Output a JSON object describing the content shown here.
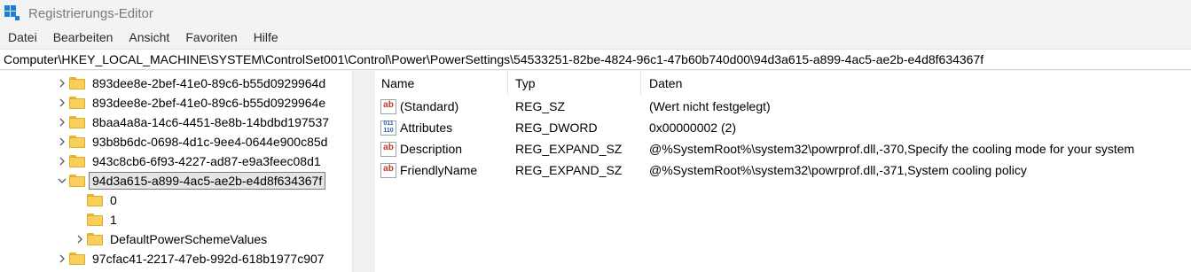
{
  "window": {
    "title": "Registrierungs-Editor"
  },
  "menu": [
    "Datei",
    "Bearbeiten",
    "Ansicht",
    "Favoriten",
    "Hilfe"
  ],
  "address": "Computer\\HKEY_LOCAL_MACHINE\\SYSTEM\\ControlSet001\\Control\\Power\\PowerSettings\\54533251-82be-4824-96c1-47b60b740d00\\94d3a615-a899-4ac5-ae2b-e4d8f634367f",
  "tree": [
    {
      "label": "893dee8e-2bef-41e0-89c6-b55d0929964d",
      "expander": "collapsed",
      "selected": false
    },
    {
      "label": "893dee8e-2bef-41e0-89c6-b55d0929964e",
      "expander": "collapsed",
      "selected": false
    },
    {
      "label": "8baa4a8a-14c6-4451-8e8b-14bdbd197537",
      "expander": "collapsed",
      "selected": false
    },
    {
      "label": "93b8b6dc-0698-4d1c-9ee4-0644e900c85d",
      "expander": "collapsed",
      "selected": false
    },
    {
      "label": "943c8cb6-6f93-4227-ad87-e9a3feec08d1",
      "expander": "collapsed",
      "selected": false
    },
    {
      "label": "94d3a615-a899-4ac5-ae2b-e4d8f634367f",
      "expander": "expanded",
      "selected": true
    },
    {
      "label": "0",
      "expander": "none",
      "selected": false
    },
    {
      "label": "1",
      "expander": "none",
      "selected": false
    },
    {
      "label": "DefaultPowerSchemeValues",
      "expander": "collapsed",
      "selected": false
    },
    {
      "label": "97cfac41-2217-47eb-992d-618b1977c907",
      "expander": "collapsed",
      "selected": false
    }
  ],
  "columns": {
    "name": "Name",
    "type": "Typ",
    "data": "Daten"
  },
  "values": [
    {
      "name": "(Standard)",
      "type": "REG_SZ",
      "data": "(Wert nicht festgelegt)",
      "icon": "string-value-icon"
    },
    {
      "name": "Attributes",
      "type": "REG_DWORD",
      "data": "0x00000002 (2)",
      "icon": "binary-value-icon"
    },
    {
      "name": "Description",
      "type": "REG_EXPAND_SZ",
      "data": "@%SystemRoot%\\system32\\powrprof.dll,-370,Specify the cooling mode for your system",
      "icon": "string-value-icon"
    },
    {
      "name": "FriendlyName",
      "type": "REG_EXPAND_SZ",
      "data": "@%SystemRoot%\\system32\\powrprof.dll,-371,System cooling policy",
      "icon": "string-value-icon"
    }
  ],
  "colors": {
    "folder": "#f8cf5a",
    "app_icon": "#1e7fd6",
    "selection": "#e5e5e5"
  }
}
